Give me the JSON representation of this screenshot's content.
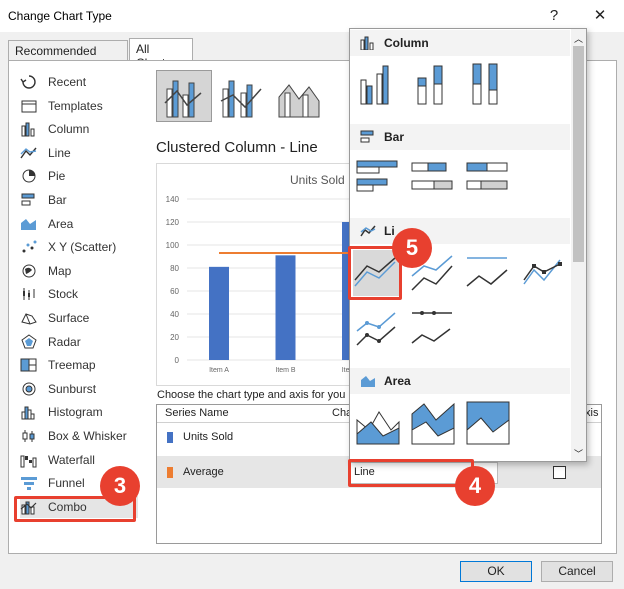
{
  "window": {
    "title": "Change Chart Type",
    "help": "?",
    "close": "✕"
  },
  "tabs": [
    "Recommended Charts",
    "All Charts"
  ],
  "left_items": [
    {
      "label": "Recent",
      "icon": "recent-icon"
    },
    {
      "label": "Templates",
      "icon": "templates-icon"
    },
    {
      "label": "Column",
      "icon": "column-chart-icon"
    },
    {
      "label": "Line",
      "icon": "line-chart-icon"
    },
    {
      "label": "Pie",
      "icon": "pie-chart-icon"
    },
    {
      "label": "Bar",
      "icon": "bar-chart-icon"
    },
    {
      "label": "Area",
      "icon": "area-chart-icon"
    },
    {
      "label": "X Y (Scatter)",
      "icon": "scatter-chart-icon"
    },
    {
      "label": "Map",
      "icon": "map-chart-icon"
    },
    {
      "label": "Stock",
      "icon": "stock-chart-icon"
    },
    {
      "label": "Surface",
      "icon": "surface-chart-icon"
    },
    {
      "label": "Radar",
      "icon": "radar-chart-icon"
    },
    {
      "label": "Treemap",
      "icon": "treemap-chart-icon"
    },
    {
      "label": "Sunburst",
      "icon": "sunburst-chart-icon"
    },
    {
      "label": "Histogram",
      "icon": "histogram-chart-icon"
    },
    {
      "label": "Box & Whisker",
      "icon": "box-whisker-chart-icon"
    },
    {
      "label": "Waterfall",
      "icon": "waterfall-chart-icon"
    },
    {
      "label": "Funnel",
      "icon": "funnel-chart-icon"
    },
    {
      "label": "Combo",
      "icon": "combo-chart-icon"
    }
  ],
  "main": {
    "heading": "Clustered Column - Line",
    "choose_text": "Choose the chart type and axis for you",
    "grid_headers": {
      "series_name": "Series Name",
      "chart_type": "Cha",
      "axis": "xis"
    },
    "series": [
      {
        "name": "Units Sold",
        "color": "#4472c4"
      },
      {
        "name": "Average",
        "color": "#ed7d31",
        "chart_type": "Line"
      }
    ]
  },
  "popup": {
    "sections": [
      "Column",
      "Bar",
      "Line",
      "Area"
    ],
    "line_partial": "Li"
  },
  "chart_data": {
    "type": "bar",
    "title": "Units Sold",
    "categories": [
      "Item A",
      "Item B",
      "Item C"
    ],
    "series": [
      {
        "values": [
          81,
          91,
          120
        ]
      }
    ],
    "average": 93,
    "ylim": [
      0,
      140
    ],
    "yticks": [
      "0",
      "20",
      "40",
      "60",
      "80",
      "100",
      "120",
      "140"
    ]
  },
  "badges": [
    "3",
    "4",
    "5"
  ],
  "buttons": {
    "ok": "OK",
    "cancel": "Cancel"
  },
  "colors": {
    "accent": "#e8402f",
    "series_blue": "#4472c4",
    "series_orange": "#ed7d31",
    "popup_blue": "#5b9bd5"
  }
}
